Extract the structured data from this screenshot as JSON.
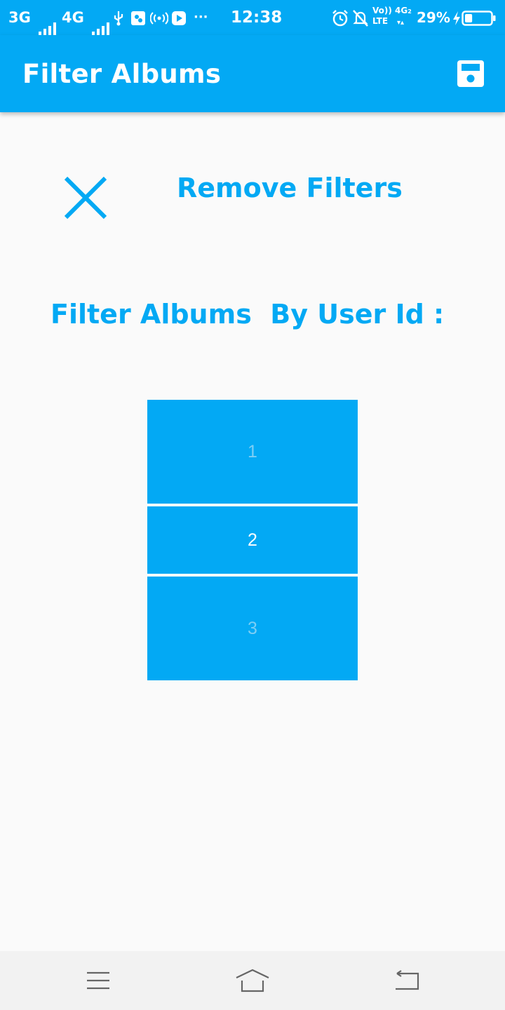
{
  "status_bar": {
    "network_1": "3G",
    "network_2": "4G",
    "more": "···",
    "time": "12:38",
    "volte_top": "Vo))",
    "volte_bottom": "LTE",
    "net_4g": "4G",
    "net_4g_sub": "2",
    "battery": "29%",
    "battery_level": 0.29
  },
  "toolbar": {
    "title": "Filter Albums",
    "save_icon": "save-icon"
  },
  "remove_filters": {
    "icon": "close-icon",
    "label": "Remove Filters"
  },
  "section": {
    "title": "Filter Albums  By User Id :"
  },
  "picker": {
    "items": [
      "1",
      "2",
      "3"
    ],
    "selected": "2"
  },
  "nav_bar": {
    "menu_icon": "menu-icon",
    "home_icon": "home-icon",
    "back_icon": "back-icon"
  },
  "colors": {
    "primary": "#03a9f4",
    "background": "#fafafa",
    "picker_dim_text": "#7ccef5"
  }
}
